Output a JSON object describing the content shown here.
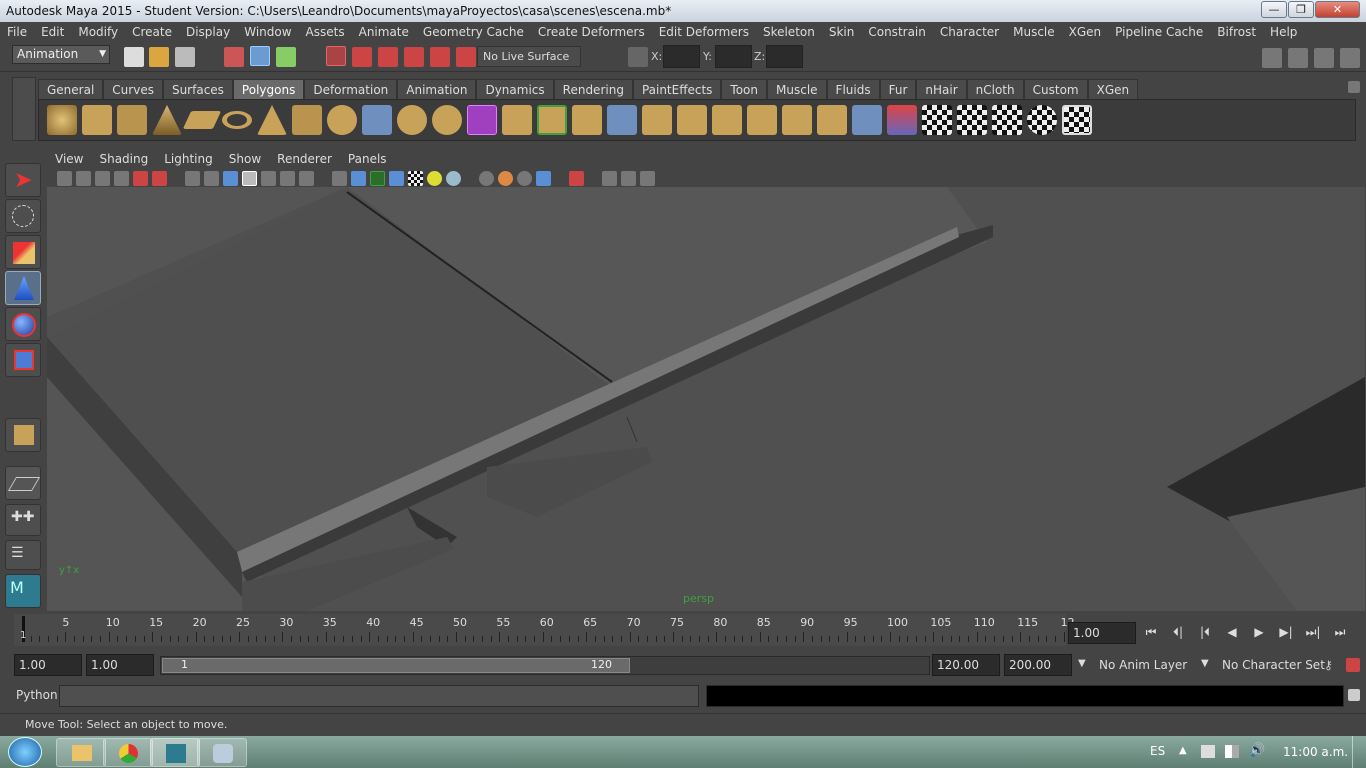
{
  "window": {
    "title": "Autodesk Maya 2015 - Student Version: C:\\Users\\Leandro\\Documents\\mayaProyectos\\casa\\scenes\\escena.mb*",
    "minimize": "—",
    "maximize": "❐",
    "close": "✕"
  },
  "menubar": {
    "items": [
      "File",
      "Edit",
      "Modify",
      "Create",
      "Display",
      "Window",
      "Assets",
      "Animate",
      "Geometry Cache",
      "Create Deformers",
      "Edit Deformers",
      "Skeleton",
      "Skin",
      "Constrain",
      "Character",
      "Muscle",
      "XGen",
      "Pipeline Cache",
      "Bifrost",
      "Help"
    ]
  },
  "statusline": {
    "mode": "Animation",
    "live_surface": "No Live Surface",
    "x_label": "X:",
    "y_label": "Y:",
    "z_label": "Z:"
  },
  "shelf": {
    "tabs": [
      "General",
      "Curves",
      "Surfaces",
      "Polygons",
      "Deformation",
      "Animation",
      "Dynamics",
      "Rendering",
      "PaintEffects",
      "Toon",
      "Muscle",
      "Fluids",
      "Fur",
      "nHair",
      "nCloth",
      "Custom",
      "XGen"
    ],
    "active_tab": "Polygons"
  },
  "viewport": {
    "menus": [
      "View",
      "Shading",
      "Lighting",
      "Show",
      "Renderer",
      "Panels"
    ],
    "camera_label": "persp"
  },
  "timeline": {
    "ticks": [
      "5",
      "10",
      "15",
      "20",
      "25",
      "30",
      "35",
      "40",
      "45",
      "50",
      "55",
      "60",
      "65",
      "70",
      "75",
      "80",
      "85",
      "90",
      "95",
      "100",
      "105",
      "110",
      "115",
      "12"
    ],
    "current_frame_marker": "1",
    "current_time": "1.00"
  },
  "playback": {
    "buttons": [
      "⏮",
      "⏴|",
      "|⏴",
      "◀",
      "▶",
      "▶|",
      "⏭|",
      "⏭"
    ]
  },
  "range": {
    "start_time": "1.00",
    "playback_start": "1.00",
    "slider_start": "1",
    "slider_end": "120",
    "playback_end": "120.00",
    "end_time": "200.00",
    "anim_layer": "No Anim Layer",
    "character_set": "No Character Set"
  },
  "cmdline": {
    "label": "Python"
  },
  "helpline": {
    "text": "Move Tool: Select an object to move."
  },
  "taskbar": {
    "language": "ES",
    "clock": "11:00 a.m."
  },
  "colors": {
    "accent_green": "#3fa03f",
    "viewport_bg": "#5a5a5a"
  }
}
